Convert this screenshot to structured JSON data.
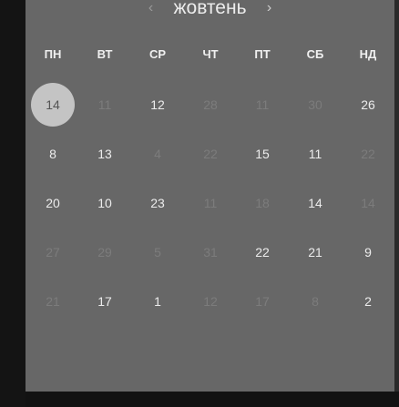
{
  "calendar": {
    "month": "жовтень",
    "prev_icon": "‹",
    "next_icon": "›",
    "weekdays": [
      "ПН",
      "ВТ",
      "СР",
      "ЧТ",
      "ПТ",
      "СБ",
      "НД"
    ],
    "weeks": [
      [
        {
          "label": "14",
          "muted": false,
          "selected": true
        },
        {
          "label": "11",
          "muted": true,
          "selected": false
        },
        {
          "label": "12",
          "muted": false,
          "selected": false
        },
        {
          "label": "28",
          "muted": true,
          "selected": false
        },
        {
          "label": "11",
          "muted": true,
          "selected": false
        },
        {
          "label": "30",
          "muted": true,
          "selected": false
        },
        {
          "label": "26",
          "muted": false,
          "selected": false
        }
      ],
      [
        {
          "label": "8",
          "muted": false,
          "selected": false
        },
        {
          "label": "13",
          "muted": false,
          "selected": false
        },
        {
          "label": "4",
          "muted": true,
          "selected": false
        },
        {
          "label": "22",
          "muted": true,
          "selected": false
        },
        {
          "label": "15",
          "muted": false,
          "selected": false
        },
        {
          "label": "11",
          "muted": false,
          "selected": false
        },
        {
          "label": "22",
          "muted": true,
          "selected": false
        }
      ],
      [
        {
          "label": "20",
          "muted": false,
          "selected": false
        },
        {
          "label": "10",
          "muted": false,
          "selected": false
        },
        {
          "label": "23",
          "muted": false,
          "selected": false
        },
        {
          "label": "11",
          "muted": true,
          "selected": false
        },
        {
          "label": "18",
          "muted": true,
          "selected": false
        },
        {
          "label": "14",
          "muted": false,
          "selected": false
        },
        {
          "label": "14",
          "muted": true,
          "selected": false
        }
      ],
      [
        {
          "label": "27",
          "muted": true,
          "selected": false
        },
        {
          "label": "29",
          "muted": true,
          "selected": false
        },
        {
          "label": "5",
          "muted": true,
          "selected": false
        },
        {
          "label": "31",
          "muted": true,
          "selected": false
        },
        {
          "label": "22",
          "muted": false,
          "selected": false
        },
        {
          "label": "21",
          "muted": false,
          "selected": false
        },
        {
          "label": "9",
          "muted": false,
          "selected": false
        }
      ],
      [
        {
          "label": "21",
          "muted": true,
          "selected": false
        },
        {
          "label": "17",
          "muted": false,
          "selected": false
        },
        {
          "label": "1",
          "muted": false,
          "selected": false
        },
        {
          "label": "12",
          "muted": true,
          "selected": false
        },
        {
          "label": "17",
          "muted": true,
          "selected": false
        },
        {
          "label": "8",
          "muted": true,
          "selected": false
        },
        {
          "label": "2",
          "muted": false,
          "selected": false
        }
      ]
    ]
  }
}
